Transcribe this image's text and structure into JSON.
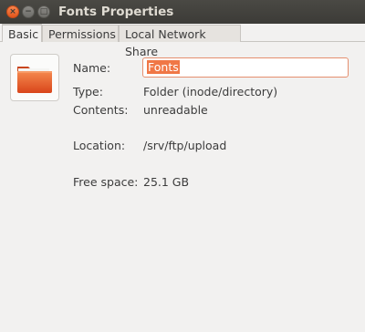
{
  "window": {
    "title": "Fonts Properties",
    "controls": {
      "close": "×",
      "minimize": "−",
      "maximize": "□"
    }
  },
  "tabs": [
    {
      "label": "Basic",
      "active": true
    },
    {
      "label": "Permissions",
      "active": false
    },
    {
      "label": "Local Network Share",
      "active": false
    }
  ],
  "basic": {
    "icon": "folder-icon",
    "name": {
      "label": "Name:",
      "value": "Fonts"
    },
    "type": {
      "label": "Type:",
      "value": "Folder (inode/directory)"
    },
    "contents": {
      "label": "Contents:",
      "value": "unreadable"
    },
    "location": {
      "label": "Location:",
      "value": "/srv/ftp/upload"
    },
    "free_space": {
      "label": "Free space:",
      "value": "25.1 GB"
    }
  },
  "colors": {
    "accent": "#f07746",
    "titlebar": "#3c3b37",
    "close_button": "#e95420"
  }
}
